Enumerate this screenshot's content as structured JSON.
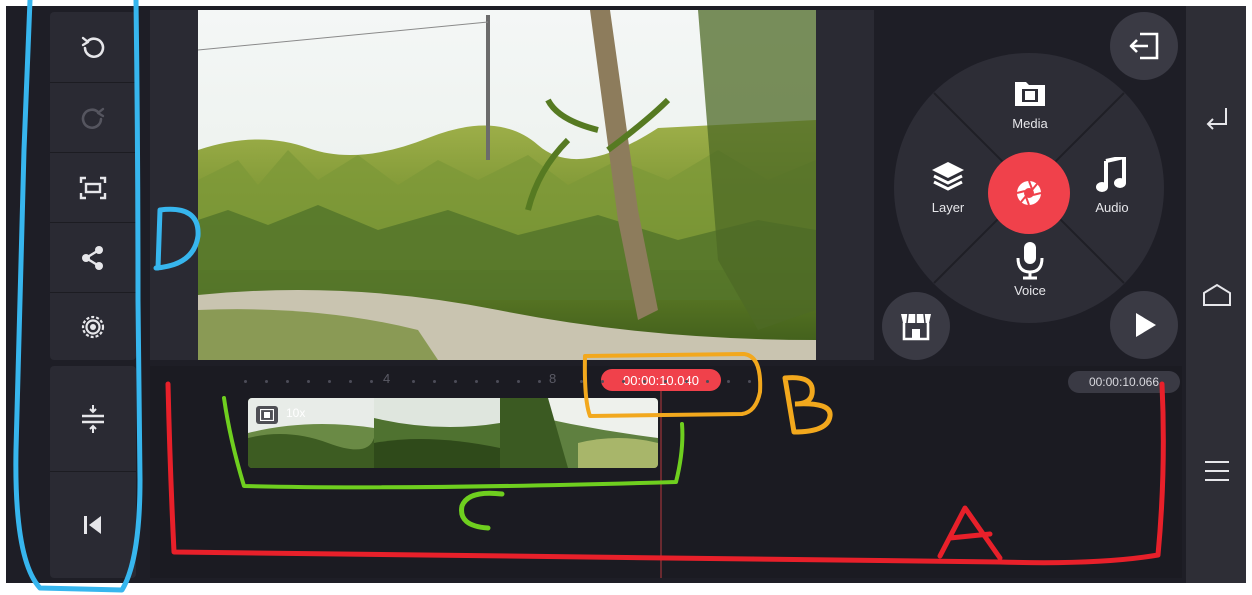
{
  "toolbar": {
    "buttons": [
      {
        "icon": "undo-icon",
        "interactable": true
      },
      {
        "icon": "redo-icon",
        "interactable": true,
        "state": "disabled"
      },
      {
        "icon": "aspect-ratio-icon",
        "interactable": true
      },
      {
        "icon": "share-icon",
        "interactable": true
      },
      {
        "icon": "settings-icon",
        "interactable": true
      }
    ],
    "lower_buttons": [
      {
        "icon": "timeline-expand-icon"
      },
      {
        "icon": "skip-to-start-icon"
      }
    ]
  },
  "wheel": {
    "media_label": "Media",
    "layer_label": "Layer",
    "audio_label": "Audio",
    "voice_label": "Voice",
    "record_icon": "camera-shutter-icon"
  },
  "buttons": {
    "exit_icon": "exit-icon",
    "store_icon": "store-icon",
    "play_icon": "play-icon"
  },
  "timeline": {
    "ruler_labels": [
      "4",
      "8"
    ],
    "playhead_time": "00:00:10.040",
    "total_time": "00:00:10.066",
    "clip_speed": "10x"
  },
  "system_nav": {
    "back_icon": "back-icon",
    "home_icon": "home-icon",
    "menu_icon": "menu-icon"
  },
  "annotations": {
    "labels": [
      "A",
      "B",
      "C",
      "D"
    ],
    "colors": {
      "A": "#e8202a",
      "B": "#f2a81d",
      "C": "#6fcf1f",
      "D": "#37b6ee"
    }
  },
  "colors": {
    "accent": "#f0414b",
    "panel": "#2a2a33",
    "background": "#1e1e26"
  }
}
